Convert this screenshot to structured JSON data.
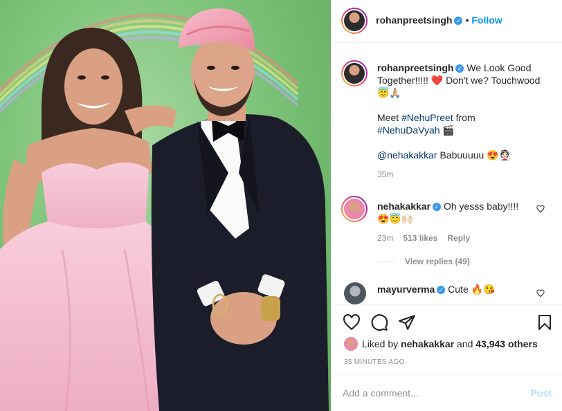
{
  "post": {
    "author": "rohanpreetsingh",
    "follow_label": "Follow",
    "caption_p1": "We Look Good Together!!!!! ❤️ Don't we? Touchwood 😇🙏🏼",
    "caption_p2_prefix": "Meet ",
    "hashtag1": "#NehuPreet",
    "caption_p2_mid": " from ",
    "hashtag2": "#NehuDaVyah",
    "caption_p2_suffix": " 🎬",
    "mention": "@nehakakkar",
    "caption_p3_suffix": " Babuuuuu 😍👰🏻",
    "caption_time": "35m"
  },
  "comments": [
    {
      "user": "nehakakkar",
      "text": "Oh yesss baby!!!! 😍😇🙌🏻",
      "time": "23m",
      "likes": "513 likes",
      "reply_label": "Reply",
      "view_replies": "View replies (49)"
    },
    {
      "user": "mayurverma",
      "text": "Cute 🔥😘"
    }
  ],
  "likes": {
    "prefix": "Liked by ",
    "user": "nehakakkar",
    "middle": " and ",
    "count": "43,943 others"
  },
  "time_ago": "35 MINUTES AGO",
  "add_comment": {
    "placeholder": "Add a comment...",
    "post_label": "Post"
  },
  "colors": {
    "accent": "#0095f6",
    "verified": "#3897f0",
    "turban": "#f4a7b9",
    "dress": "#f6c3d3",
    "background": "#7ec47a"
  },
  "icons": [
    "heart-icon",
    "comment-icon",
    "share-icon",
    "bookmark-icon",
    "verified-icon",
    "heart-outline-icon"
  ]
}
